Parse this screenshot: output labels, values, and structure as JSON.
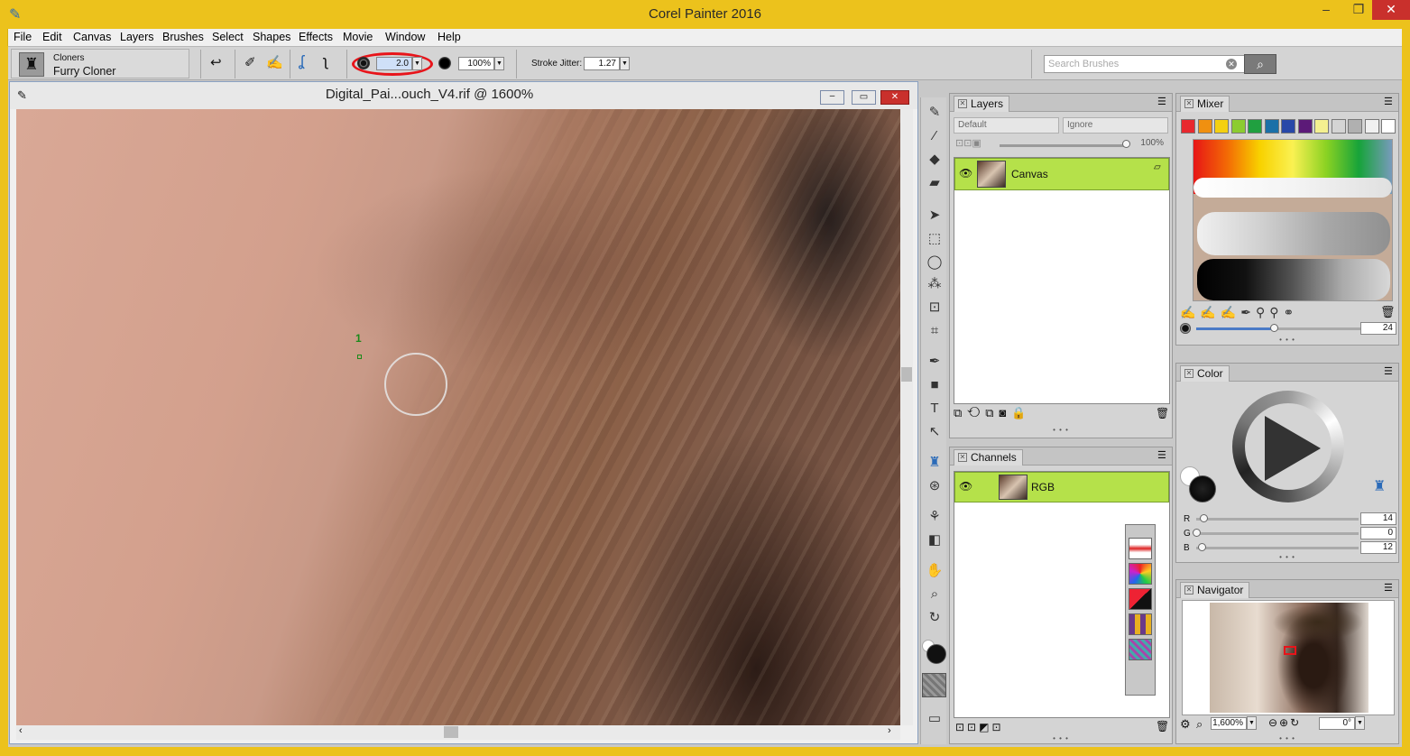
{
  "app": {
    "title": "Corel Painter 2016"
  },
  "menu": [
    "File",
    "Edit",
    "Canvas",
    "Layers",
    "Brushes",
    "Select",
    "Shapes",
    "Effects",
    "Movie",
    "Window",
    "Help"
  ],
  "brush": {
    "category": "Cloners",
    "variant": "Furry Cloner"
  },
  "properties": {
    "size": "2.0",
    "opacity": "100%",
    "stroke_jitter_label": "Stroke Jitter:",
    "stroke_jitter": "1.27",
    "search_placeholder": "Search Brushes"
  },
  "document": {
    "title": "Digital_Pai...ouch_V4.rif @ 1600%",
    "clone_source_label": "1"
  },
  "layers": {
    "tab": "Layers",
    "composite_method": "Default",
    "depth": "Ignore",
    "opacity": "100%",
    "items": [
      {
        "name": "Canvas"
      }
    ]
  },
  "channels": {
    "tab": "Channels",
    "items": [
      {
        "name": "RGB"
      }
    ]
  },
  "mixer": {
    "tab": "Mixer",
    "brush_size": "24",
    "swatches": [
      "#e8282e",
      "#f09010",
      "#f4d010",
      "#8ccc30",
      "#20a040",
      "#1a70a8",
      "#2848a8",
      "#5c1a78",
      "#f4f090",
      "#d4d4d4",
      "#b0b0b0",
      "#f0f0f0",
      "#ffffff"
    ]
  },
  "color": {
    "tab": "Color",
    "r": "14",
    "g": "0",
    "b": "12",
    "r_label": "R",
    "g_label": "G",
    "b_label": "B"
  },
  "navigator": {
    "tab": "Navigator",
    "zoom": "1,600%",
    "rotation": "0°"
  }
}
